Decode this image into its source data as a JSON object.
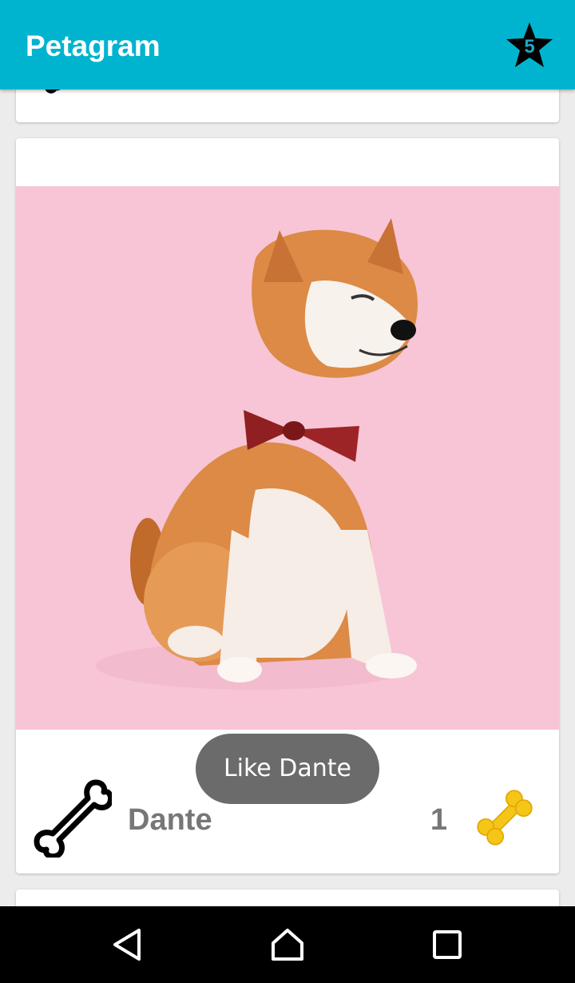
{
  "app": {
    "title": "Petagram"
  },
  "toolbar": {
    "favorites_count": "5",
    "favorites_icon": "star-icon"
  },
  "colors": {
    "appbar": "#00b4cf",
    "bone_gold": "#f5c518",
    "text_gray": "#777777",
    "photo_bg": "#f7c5d6"
  },
  "feed": {
    "cards": [
      {
        "name": "Dante",
        "likes": "1",
        "like_icon": "bone-outline-icon",
        "count_icon": "bone-gold-icon"
      }
    ]
  },
  "toast": {
    "text": "Like Dante"
  },
  "navbar": {
    "back_icon": "back-triangle-icon",
    "home_icon": "home-icon",
    "recents_icon": "recents-square-icon"
  }
}
